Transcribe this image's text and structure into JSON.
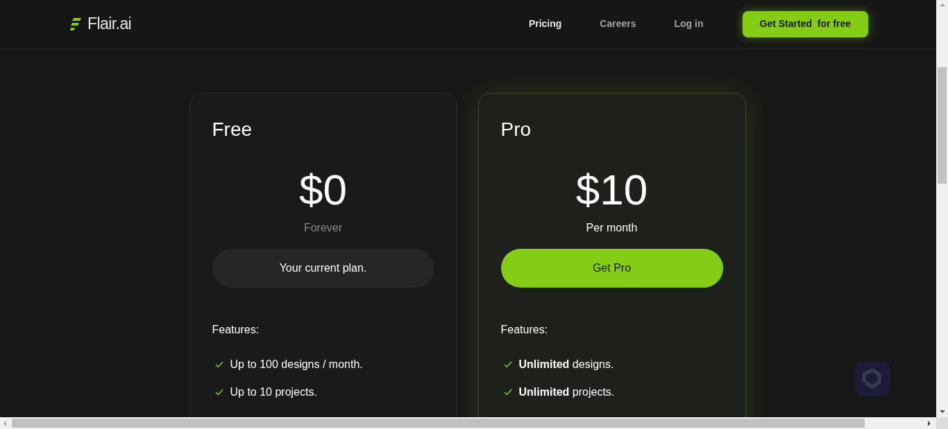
{
  "header": {
    "logo": "Flair.ai",
    "nav": [
      {
        "label": "Pricing",
        "selected": true
      },
      {
        "label": "Careers",
        "selected": false
      },
      {
        "label": "Log in",
        "selected": false
      }
    ],
    "cta": "Get Started  for free"
  },
  "plans": [
    {
      "name": "Free",
      "price": "$0",
      "period": "Forever",
      "button": "Your current plan.",
      "highlighted": false,
      "features_label": "Features:",
      "features": [
        "Up to 100 designs / month.",
        "Up to 10 projects."
      ]
    },
    {
      "name": "Pro",
      "price": "$10",
      "period": "Per month",
      "button": "Get Pro",
      "highlighted": true,
      "features_label": "Features:",
      "features": [
        "**Unlimited** designs.",
        "**Unlimited** projects."
      ]
    }
  ]
}
